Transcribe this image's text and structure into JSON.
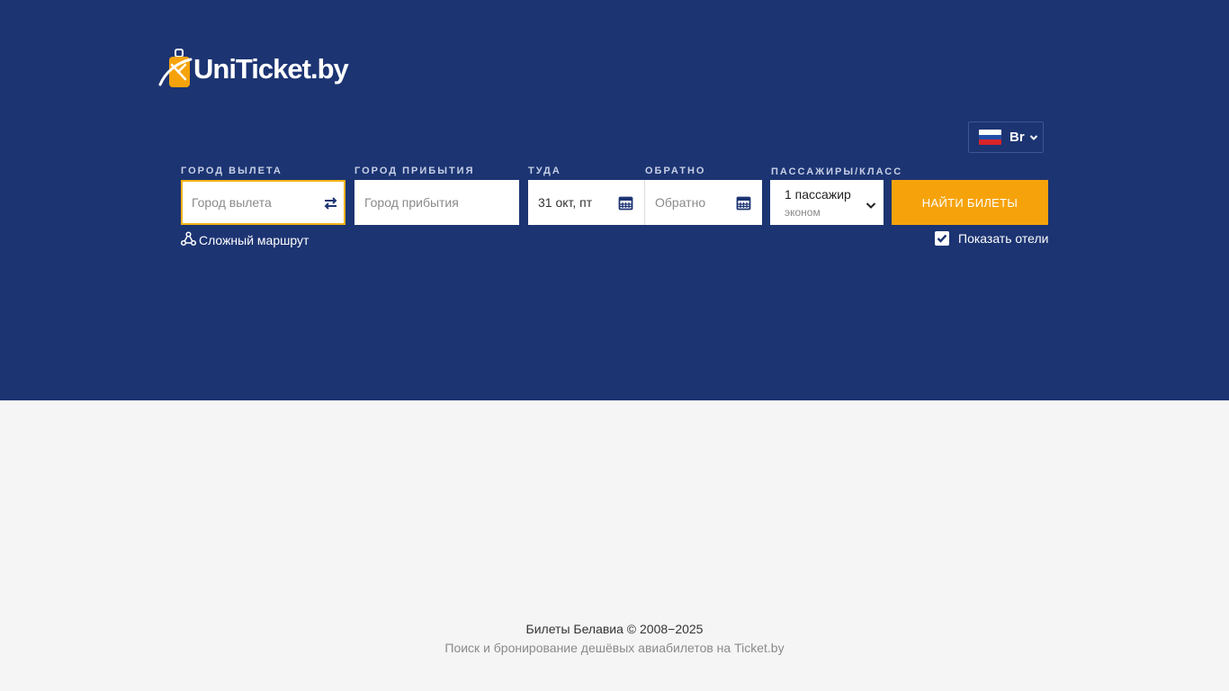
{
  "brand": {
    "name": "UniTicket.by",
    "colors": {
      "header_bg": "#1c3472",
      "accent": "#f6a30b",
      "focus": "#f4b216"
    }
  },
  "currency": {
    "label": "Br",
    "flag": "russia-flag-icon"
  },
  "search": {
    "from": {
      "label": "ГОРОД ВЫЛЕТА",
      "placeholder": "Город вылета",
      "value": ""
    },
    "to": {
      "label": "ГОРОД ПРИБЫТИЯ",
      "placeholder": "Город прибытия",
      "value": ""
    },
    "depart": {
      "label": "ТУДА",
      "value": "31 окт, пт"
    },
    "return": {
      "label": "ОБРАТНО",
      "placeholder": "Обратно",
      "value": ""
    },
    "passengers": {
      "label": "ПАССАЖИРЫ/КЛАСС",
      "count": "1 пассажир",
      "class": "эконом"
    },
    "submit_label": "НАЙТИ БИЛЕТЫ",
    "complex_route_label": "Сложный маршрут",
    "show_hotels": {
      "label": "Показать отели",
      "checked": true
    }
  },
  "footer": {
    "line1": "Билеты Белавиа © 2008−2025",
    "line2": "Поиск и бронирование дешёвых авиабилетов на Ticket.by"
  }
}
